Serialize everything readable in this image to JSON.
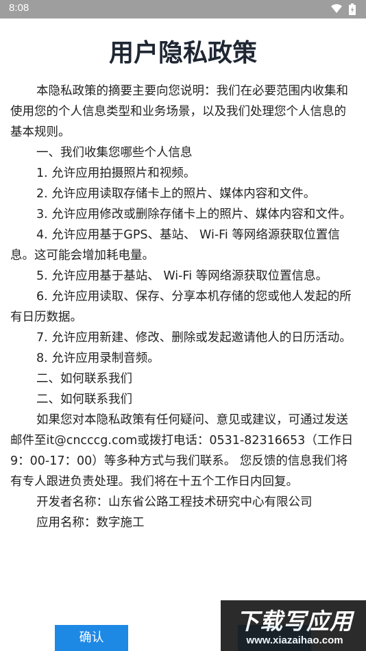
{
  "status_bar": {
    "time": "8:08"
  },
  "page": {
    "title": "用户隐私政策"
  },
  "paragraphs": [
    "本隐私政策的摘要主要向您说明：我们在必要范围内收集和使用您的个人信息类型和业务场景，以及我们处理您个人信息的基本规则。",
    "一、我们收集您哪些个人信息",
    "1. 允许应用拍摄照片和视频。",
    "2. 允许应用读取存储卡上的照片、媒体内容和文件。",
    "3. 允许应用修改或删除存储卡上的照片、媒体内容和文件。",
    "4. 允许应用基于GPS、基站、 Wi-Fi 等网络源获取位置信息。这可能会增加耗电量。",
    "5. 允许应用基于基站、 Wi-Fi 等网络源获取位置信息。",
    "6. 允许应用读取、保存、分享本机存储的您或他人发起的所有日历数据。",
    "7. 允许应用新建、修改、删除或发起邀请他人的日历活动。",
    "8. 允许应用录制音频。",
    "二、如何联系我们",
    "二、如何联系我们",
    "如果您对本隐私政策有任何疑问、意见或建议，可通过发送邮件至it@cncccg.com或拨打电话：0531-82316653（工作日9：00-17：00）等多种方式与我们联系。 您反馈的信息我们将有专人跟进负责处理。我们将在十五个工作日内回复。",
    "开发者名称：山东省公路工程技术研究中心有限公司",
    "应用名称：数字施工"
  ],
  "buttons": {
    "confirm": "确认"
  },
  "watermark": {
    "text": "下载写应用",
    "url": "www.xiazaihao.com"
  }
}
